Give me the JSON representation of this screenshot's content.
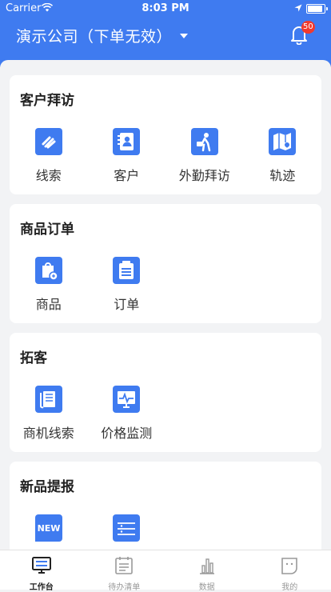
{
  "status": {
    "carrier": "Carrier",
    "time": "8:03 PM"
  },
  "header": {
    "company": "演示公司（下单无效）",
    "badge": "50"
  },
  "sections": [
    {
      "title": "客户拜访",
      "items": [
        {
          "label": "线索",
          "icon": "clue-icon"
        },
        {
          "label": "客户",
          "icon": "customer-icon"
        },
        {
          "label": "外勤拜访",
          "icon": "field-visit-icon"
        },
        {
          "label": "轨迹",
          "icon": "track-map-icon"
        }
      ]
    },
    {
      "title": "商品订单",
      "items": [
        {
          "label": "商品",
          "icon": "product-icon"
        },
        {
          "label": "订单",
          "icon": "order-icon"
        }
      ]
    },
    {
      "title": "拓客",
      "items": [
        {
          "label": "商机线索",
          "icon": "opportunity-icon"
        },
        {
          "label": "价格监测",
          "icon": "price-monitor-icon"
        }
      ]
    },
    {
      "title": "新品提报",
      "items": [
        {
          "label": "NEW",
          "icon": "new-product-icon"
        },
        {
          "label": "",
          "icon": "cabinet-icon"
        }
      ]
    }
  ],
  "tabs": [
    {
      "label": "工作台",
      "active": true
    },
    {
      "label": "待办清单",
      "active": false
    },
    {
      "label": "数据",
      "active": false
    },
    {
      "label": "我的",
      "active": false
    }
  ],
  "colors": {
    "primary": "#3f7bf0",
    "badge": "#f03a2f",
    "background": "#f2f3f5"
  }
}
